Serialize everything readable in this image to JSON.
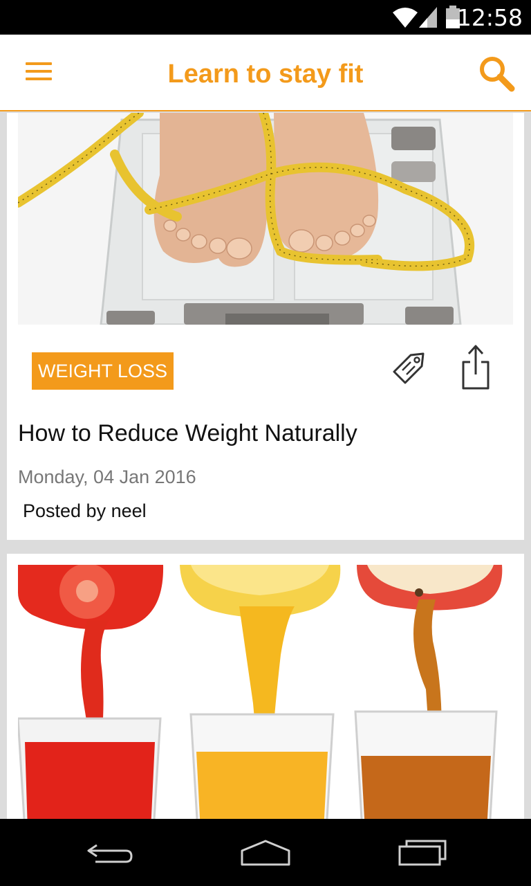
{
  "status_bar": {
    "time": "12:58",
    "icons": [
      "wifi-icon",
      "cell-signal-icon",
      "battery-icon"
    ]
  },
  "app_bar": {
    "title": "Learn to stay fit",
    "menu_icon": "hamburger-menu-icon",
    "search_icon": "search-icon"
  },
  "posts": [
    {
      "image": "feet-on-scale-with-measuring-tape",
      "category": "WEIGHT LOSS",
      "tag_icon": "tag-icon",
      "share_icon": "share-icon",
      "title": "How to Reduce Weight Naturally",
      "date": "Monday, 04 Jan 2016",
      "author": "Posted by neel"
    },
    {
      "image": "fruit-juices-pouring-into-glasses"
    }
  ],
  "nav_bar": {
    "icons": [
      "back-icon",
      "home-icon",
      "recent-apps-icon"
    ]
  },
  "colors": {
    "accent": "#f39a1b",
    "status_bar": "#000000",
    "background": "#dcdcdc"
  }
}
